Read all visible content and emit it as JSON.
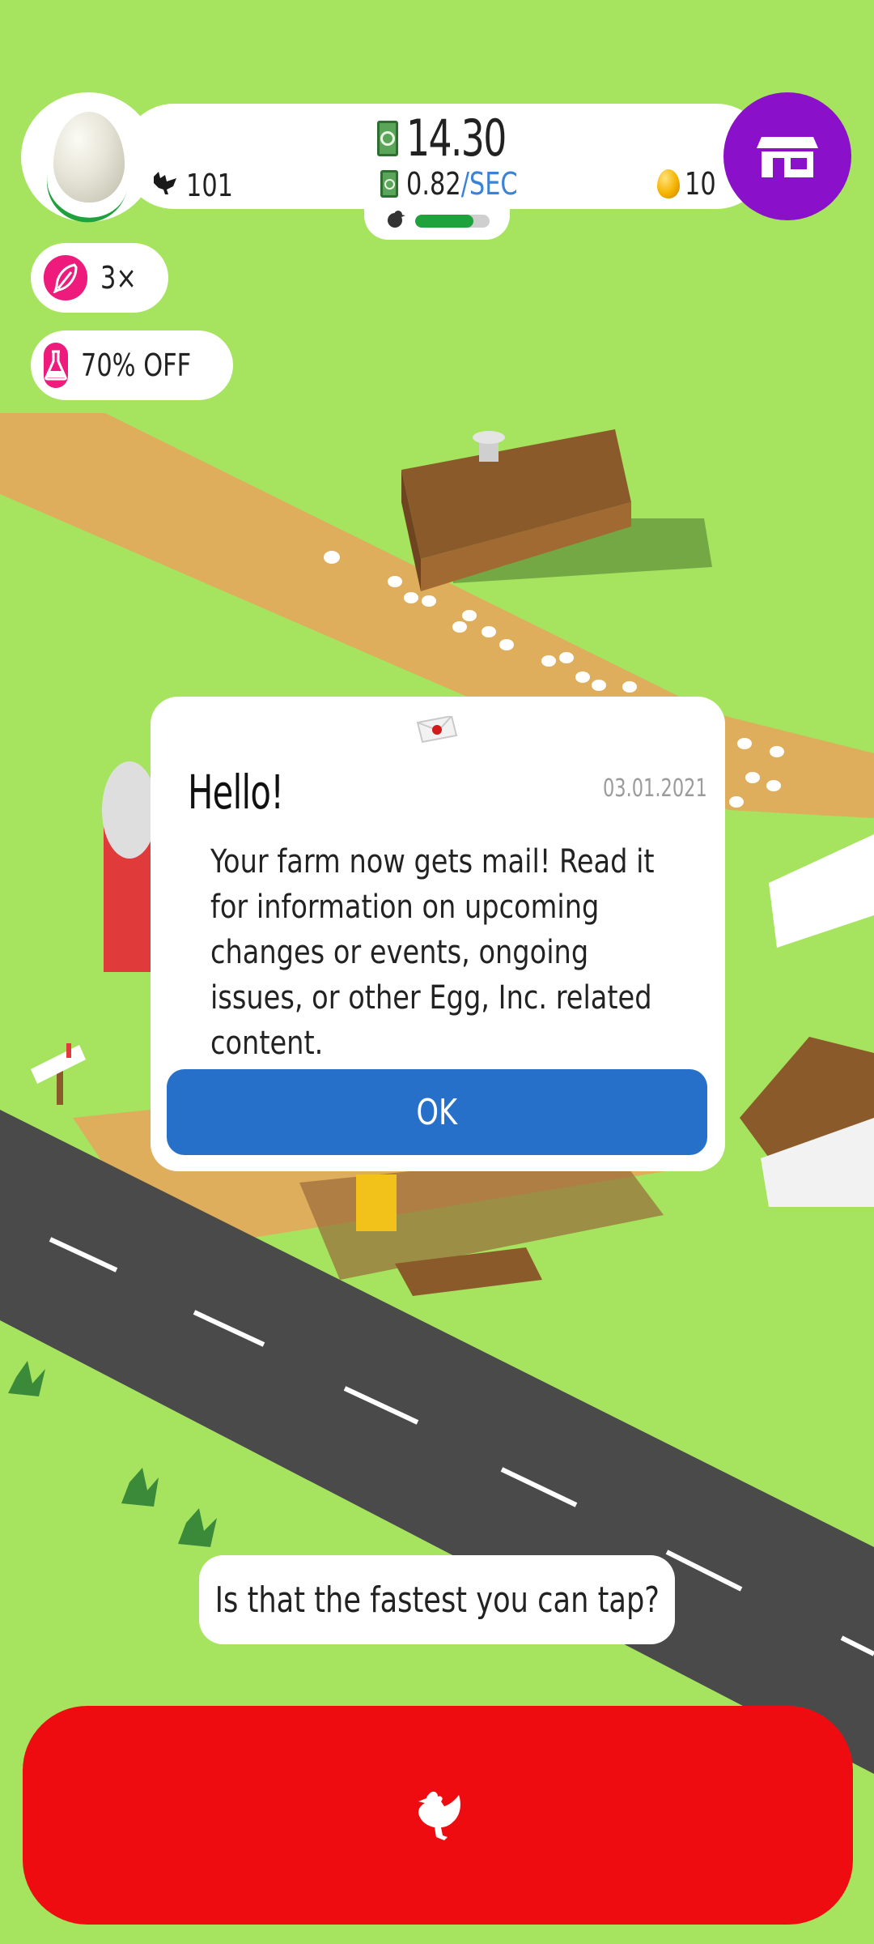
{
  "hud": {
    "money": "14.30",
    "money_rate": "0.82",
    "money_rate_unit": "/SEC",
    "chickens": "101",
    "golden_eggs": "10",
    "hab_capacity_fraction": 0.78
  },
  "boosts": [
    {
      "icon": "feather-icon",
      "label": "3×"
    },
    {
      "icon": "flask-icon",
      "label": "70% OFF"
    }
  ],
  "dialog": {
    "title": "Hello!",
    "date": "03.01.2021",
    "body": "Your farm now gets mail! Read it for information on upcoming changes or events, ongoing issues, or other Egg, Inc. related content.",
    "ok_label": "OK"
  },
  "tip": "Is that the fastest you can tap?",
  "colors": {
    "grass": "#a6e35e",
    "road": "#4a4a4a",
    "dirt": "#deae5c",
    "shop": "#8a10c9",
    "boost_pink": "#ee1a7c",
    "ok_blue": "#2670c9",
    "hatch_red": "#ee0c10",
    "progress_green": "#1fa23c",
    "rate_blue": "#3b82d6"
  }
}
